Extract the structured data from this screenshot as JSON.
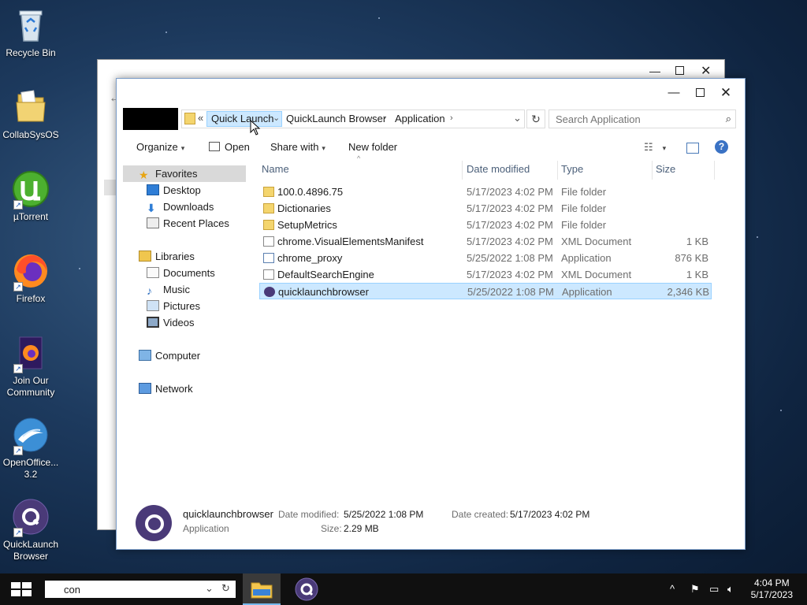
{
  "desktop": {
    "icons": [
      {
        "label": "Recycle Bin"
      },
      {
        "label": "CollabSysOS"
      },
      {
        "label": "µTorrent"
      },
      {
        "label": "Firefox"
      },
      {
        "label": "Join Our Community"
      },
      {
        "label": "OpenOffice... 3.2"
      },
      {
        "label": "QuickLaunch Browser"
      }
    ]
  },
  "explorer": {
    "breadcrumb": {
      "overflow": "«",
      "items": [
        "Quick Launch",
        "QuickLaunch Browser",
        "Application"
      ]
    },
    "search_placeholder": "Search Application",
    "toolbar": {
      "organize": "Organize",
      "open": "Open",
      "share_with": "Share with",
      "new_folder": "New folder"
    },
    "nav": {
      "favorites": "Favorites",
      "favorites_items": [
        "Desktop",
        "Downloads",
        "Recent Places"
      ],
      "libraries": "Libraries",
      "libraries_items": [
        "Documents",
        "Music",
        "Pictures",
        "Videos"
      ],
      "computer": "Computer",
      "network": "Network"
    },
    "columns": {
      "name": "Name",
      "date": "Date modified",
      "type": "Type",
      "size": "Size"
    },
    "files": [
      {
        "name": "100.0.4896.75",
        "date": "5/17/2023 4:02 PM",
        "type": "File folder",
        "size": "",
        "icon": "folder-icon"
      },
      {
        "name": "Dictionaries",
        "date": "5/17/2023 4:02 PM",
        "type": "File folder",
        "size": "",
        "icon": "folder-icon"
      },
      {
        "name": "SetupMetrics",
        "date": "5/17/2023 4:02 PM",
        "type": "File folder",
        "size": "",
        "icon": "folder-icon"
      },
      {
        "name": "chrome.VisualElementsManifest",
        "date": "5/17/2023 4:02 PM",
        "type": "XML Document",
        "size": "1 KB",
        "icon": "xml-icon"
      },
      {
        "name": "chrome_proxy",
        "date": "5/25/2022 1:08 PM",
        "type": "Application",
        "size": "876 KB",
        "icon": "app-icon"
      },
      {
        "name": "DefaultSearchEngine",
        "date": "5/17/2023 4:02 PM",
        "type": "XML Document",
        "size": "1 KB",
        "icon": "xml-icon"
      },
      {
        "name": "quicklaunchbrowser",
        "date": "5/25/2022 1:08 PM",
        "type": "Application",
        "size": "2,346 KB",
        "icon": "quicklaunch-icon",
        "selected": true
      }
    ],
    "details": {
      "name": "quicklaunchbrowser",
      "kind": "Application",
      "date_modified_label": "Date modified:",
      "date_modified": "5/25/2022 1:08 PM",
      "date_created_label": "Date created:",
      "date_created": "5/17/2023 4:02 PM",
      "size_label": "Size:",
      "size": "2.29 MB"
    }
  },
  "taskbar": {
    "search_value": "con",
    "time": "4:04 PM",
    "date": "5/17/2023"
  }
}
